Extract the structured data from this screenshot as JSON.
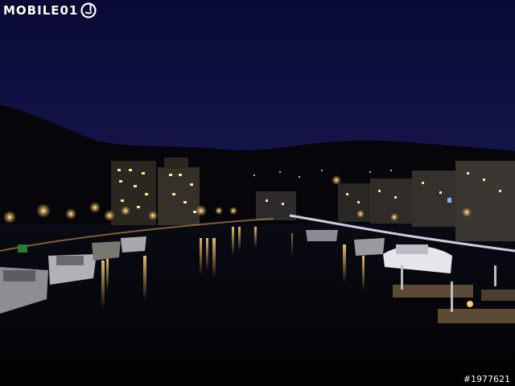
{
  "watermark": {
    "logo_text": "MOBILE01",
    "photo_id": "#1977621"
  },
  "colors": {
    "sky_top": "#0a0a35",
    "sky_bottom": "#14144a",
    "hill": "#05050a",
    "water": "#040407",
    "light_warm": "#ffd27a",
    "light_white": "#f4f4ff"
  }
}
